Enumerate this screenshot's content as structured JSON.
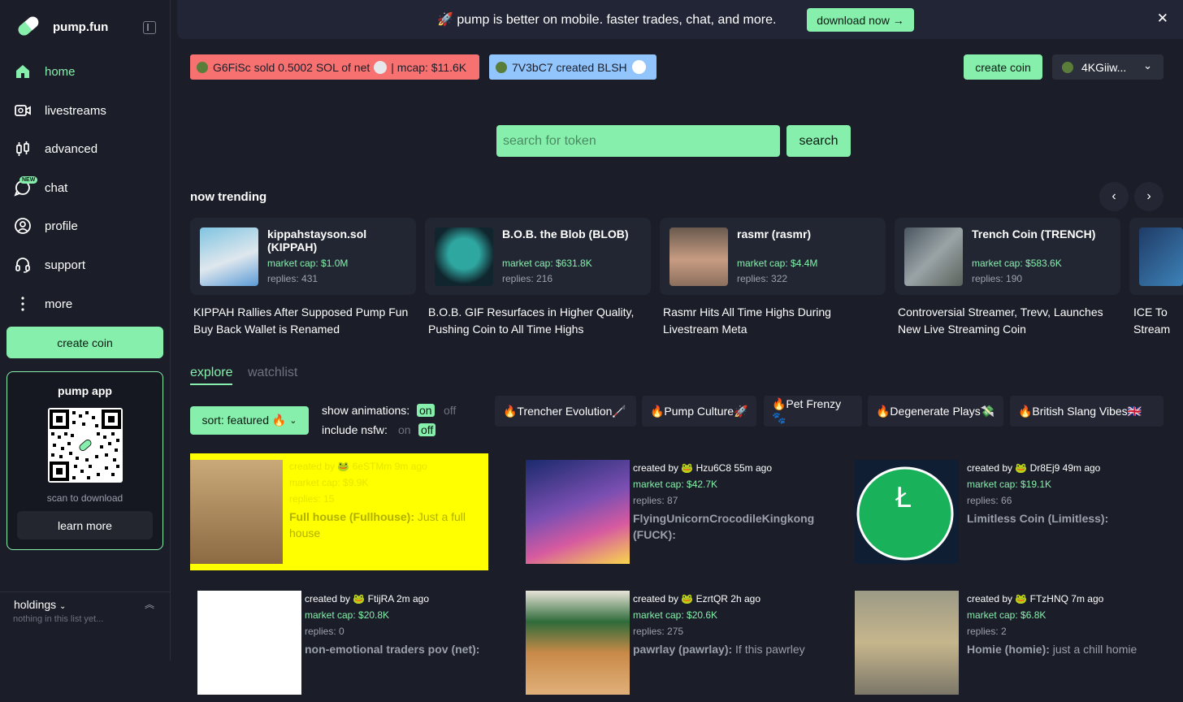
{
  "brand": {
    "name": "pump.fun"
  },
  "sidebar": {
    "items": [
      {
        "label": "home"
      },
      {
        "label": "livestreams"
      },
      {
        "label": "advanced"
      },
      {
        "label": "chat",
        "badge": "NEW"
      },
      {
        "label": "profile"
      },
      {
        "label": "support"
      },
      {
        "label": "more"
      }
    ],
    "create_label": "create coin",
    "app_card": {
      "title": "pump app",
      "scan_label": "scan to download",
      "learn_label": "learn more"
    },
    "holdings": {
      "title": "holdings",
      "empty": "nothing in this list yet..."
    }
  },
  "banner": {
    "text": "🚀 pump is better on mobile. faster trades, chat, and more.",
    "button": "download now →"
  },
  "ticker": [
    {
      "text": "G6FiSc sold 0.5002 SOL of net",
      "mcap": "| mcap: $11.6K",
      "color": "#f87171"
    },
    {
      "text": "7V3bC7 created BLSH",
      "color": "#93c5fd"
    }
  ],
  "header": {
    "create_label": "create coin",
    "wallet": "4KGiiw..."
  },
  "search": {
    "placeholder": "search for token",
    "button": "search"
  },
  "trending": {
    "title": "now trending",
    "cards": [
      {
        "name": "kippahstayson.sol (KIPPAH)",
        "mcap": "market cap: $1.0M",
        "replies": "replies: 431",
        "caption": "KIPPAH Rallies After Supposed Pump Fun Buy Back Wallet is Renamed"
      },
      {
        "name": "B.O.B. the Blob (BLOB)",
        "mcap": "market cap: $631.8K",
        "replies": "replies: 216",
        "caption": "B.O.B. GIF Resurfaces in Higher Quality, Pushing Coin to All Time Highs"
      },
      {
        "name": "rasmr (rasmr)",
        "mcap": "market cap: $4.4M",
        "replies": "replies: 322",
        "caption": "Rasmr Hits All Time Highs During Livestream Meta"
      },
      {
        "name": "Trench Coin (TRENCH)",
        "mcap": "market cap: $583.6K",
        "replies": "replies: 190",
        "caption": "Controversial Streamer, Trevv, Launches New Live Streaming Coin"
      },
      {
        "name": "",
        "mcap": "",
        "replies": "",
        "caption": "ICE To Stream"
      }
    ]
  },
  "tabs": [
    {
      "label": "explore"
    },
    {
      "label": "watchlist"
    }
  ],
  "controls": {
    "sort": "sort: featured 🔥",
    "animations_label": "show animations:",
    "nsfw_label": "include nsfw:",
    "on": "on",
    "off": "off"
  },
  "chips": [
    {
      "label": "🔥Trencher Evolution🦯"
    },
    {
      "label": "🔥Pump Culture🚀"
    },
    {
      "label": "🔥Pet Frenzy🐾"
    },
    {
      "label": "🔥Degenerate Plays💸"
    },
    {
      "label": "🔥British Slang Vibes🇬🇧"
    }
  ],
  "coins": [
    {
      "creator": "created by 🐸 6eSTMm 9m ago",
      "mcap": "market cap: $9.9K",
      "replies": "replies: 15",
      "name": "Full house (Fullhouse):",
      "desc": "Just a full house"
    },
    {
      "creator": "created by 🐸 Hzu6C8 55m ago",
      "mcap": "market cap: $42.7K",
      "replies": "replies: 87",
      "name": "FlyingUnicornCrocodileKingkong (FUCK):",
      "desc": ""
    },
    {
      "creator": "created by 🐸 Dr8Ej9 49m ago",
      "mcap": "market cap: $19.1K",
      "replies": "replies: 66",
      "name": "Limitless Coin (Limitless):",
      "desc": ""
    },
    {
      "creator": "created by 🐸 FtijRA 2m ago",
      "mcap": "market cap: $20.8K",
      "replies": "replies: 0",
      "name": "non-emotional traders pov (net):",
      "desc": ""
    },
    {
      "creator": "created by 🐸 EzrtQR 2h ago",
      "mcap": "market cap: $20.6K",
      "replies": "replies: 275",
      "name": "pawrlay (pawrlay):",
      "desc": "If this pawrley"
    },
    {
      "creator": "created by 🐸 FTzHNQ 7m ago",
      "mcap": "market cap: $6.8K",
      "replies": "replies: 2",
      "name": "Homie (homie):",
      "desc": "just a chill homie"
    }
  ],
  "colors": {
    "accent": "#86efac",
    "background": "#1b1d28",
    "card": "#222633",
    "featured": "#ffff00"
  }
}
